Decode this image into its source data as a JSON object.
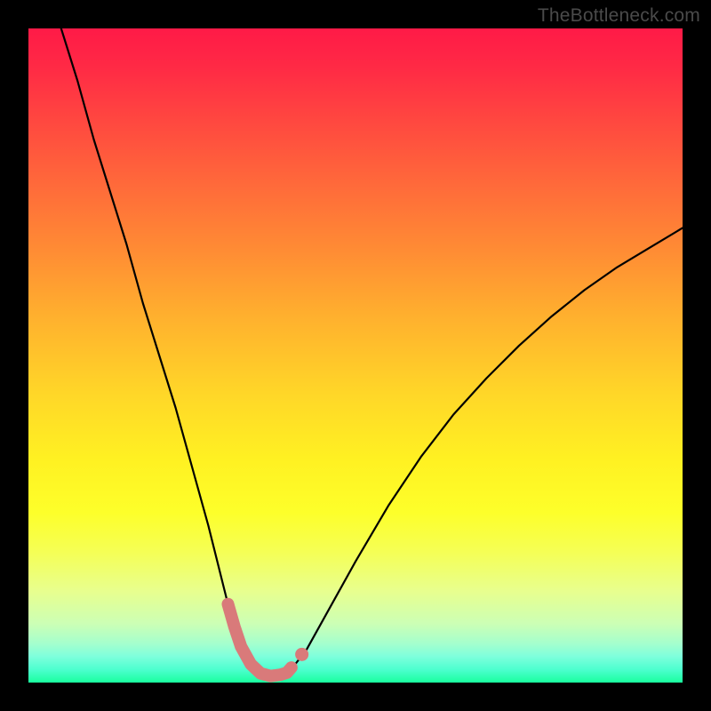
{
  "watermark": {
    "text": "TheBottleneck.com"
  },
  "chart_data": {
    "type": "line",
    "title": "",
    "xlabel": "",
    "ylabel": "",
    "xlim": [
      0,
      100
    ],
    "ylim": [
      0,
      100
    ],
    "grid": false,
    "series": [
      {
        "name": "bottleneck-curve",
        "x": [
          5,
          7.5,
          10,
          12.5,
          15,
          17.5,
          20,
          22.5,
          25,
          27.5,
          30,
          31,
          32,
          33,
          34,
          35,
          36,
          37,
          38,
          39,
          40,
          42.5,
          45,
          47.5,
          50,
          55,
          60,
          65,
          70,
          75,
          80,
          85,
          90,
          95,
          100
        ],
        "values": [
          100,
          92,
          83,
          75,
          67,
          58,
          50,
          42,
          33,
          24,
          14,
          10,
          7,
          4.5,
          2.7,
          1.6,
          1.1,
          1.0,
          1.0,
          1.2,
          1.8,
          5.0,
          9.5,
          14,
          18.5,
          27,
          34.5,
          41,
          46.5,
          51.5,
          56,
          60,
          63.5,
          66.5,
          69.5
        ]
      }
    ],
    "annotations": [
      {
        "name": "highlight-segment",
        "color": "#d97a7a",
        "x": [
          30.5,
          31.5,
          32.5,
          34,
          35.5,
          37,
          38.5,
          39.5,
          40.2
        ],
        "values": [
          12,
          8.5,
          5.5,
          2.8,
          1.4,
          1.0,
          1.2,
          1.5,
          2.3
        ]
      },
      {
        "name": "highlight-point",
        "type": "point",
        "color": "#d97a7a",
        "x": 41.8,
        "value": 4.3
      }
    ]
  }
}
